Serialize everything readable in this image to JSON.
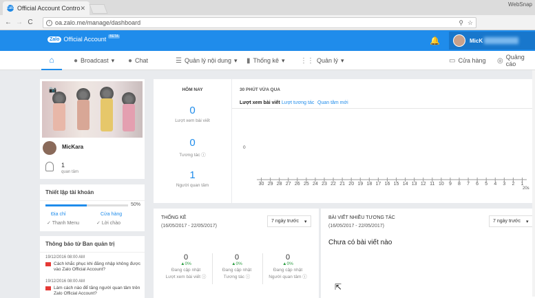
{
  "browser": {
    "tab_title": "Official Account Contro",
    "tab_favicon": "Zalo",
    "window_label": "WebSnap",
    "url": "oa.zalo.me/manage/dashboard"
  },
  "header": {
    "logo_badge": "Zalo",
    "logo_text": "Official Account",
    "beta": "BETA",
    "account_name": "MicK"
  },
  "menu": {
    "broadcast": "Broadcast",
    "chat": "Chat",
    "content": "Quản lý nội dung",
    "stats": "Thống kê",
    "manage": "Quản lý",
    "store": "Cửa hàng",
    "ads": "Quảng cáo"
  },
  "profile": {
    "name": "MicKara",
    "followers": "1",
    "followers_label": "quan tâm"
  },
  "setup": {
    "title": "Thiết lập tài khoản",
    "progress": 0.5,
    "progress_label": "50%",
    "link_address": "Địa chỉ",
    "link_store": "Cửa hàng",
    "done_menu": "Thanh Menu",
    "done_greeting": "Lời chào"
  },
  "notices": {
    "title": "Thông báo từ Ban quản trị",
    "items": [
      {
        "time": "19/12/2016 08:00 AM",
        "text": "Cách khắc phục khi đăng nhập không được vào Zalo Official Account?"
      },
      {
        "time": "19/12/2016 08:00 AM",
        "text": "Làm cách nào để tăng người quan tâm trên Zalo Official Account?"
      }
    ]
  },
  "today": {
    "title": "HÔM NAY",
    "views": "0",
    "views_label": "Lượt xem bài viết",
    "interactions": "0",
    "interactions_label": "Tương tác",
    "followers": "1",
    "followers_label": "Người quan tâm"
  },
  "realtime": {
    "title": "30 PHÚT VỪA QUA",
    "tabs": [
      "Lượt xem bài viết",
      "Lượt tương tác",
      "Quan tâm mới"
    ],
    "y_label": "0",
    "x_ticks": [
      "30",
      "29",
      "28",
      "27",
      "26",
      "25",
      "24",
      "23",
      "22",
      "21",
      "20",
      "19",
      "18",
      "17",
      "16",
      "15",
      "14",
      "13",
      "12",
      "11",
      "10",
      "9",
      "8",
      "7",
      "6",
      "5",
      "4",
      "3",
      "2",
      "1"
    ],
    "x_unit": "20s"
  },
  "stats_panel": {
    "title": "THỐNG KÊ",
    "range": "(16/05/2017 - 22/05/2017)",
    "select": "7 ngày trước",
    "kpis": [
      {
        "value": "0",
        "change": "▲0%",
        "status": "Đang cập nhật",
        "label": "Lượt xem bài viết"
      },
      {
        "value": "0",
        "change": "▲0%",
        "status": "Đang cập nhật",
        "label": "Tương tác"
      },
      {
        "value": "0",
        "change": "▲0%",
        "status": "Đang cập nhật",
        "label": "Người quan tâm"
      }
    ]
  },
  "top_posts": {
    "title": "BÀI VIẾT NHIỀU TƯƠNG TÁC",
    "range": "(16/05/2017 - 22/05/2017)",
    "select": "7 ngày trước",
    "empty": "Chưa có bài viết nào"
  }
}
